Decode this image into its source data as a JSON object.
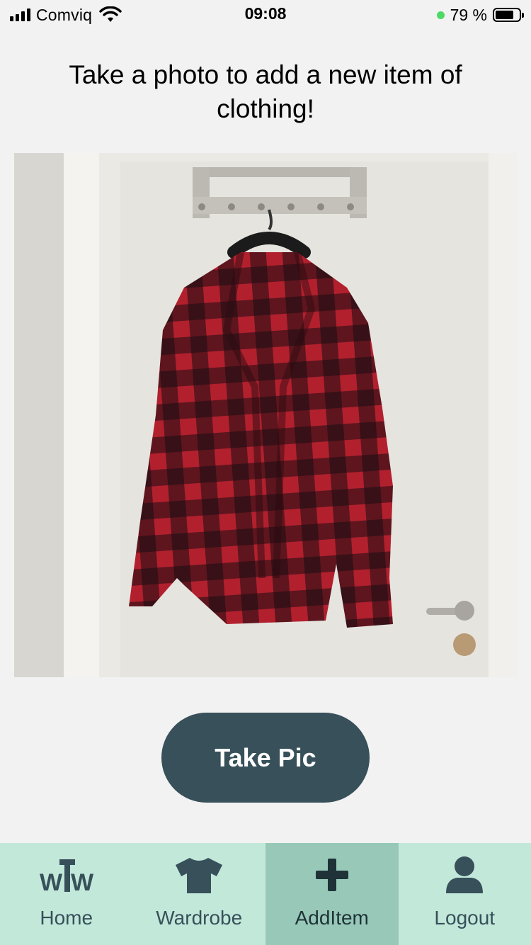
{
  "status_bar": {
    "carrier": "Comviq",
    "time": "09:08",
    "battery_text": "79 %",
    "battery_level": 0.79
  },
  "heading": "Take a photo to add a new item of clothing!",
  "photo": {
    "icon": "photo-plaid-shirt"
  },
  "take_pic_label": "Take Pic",
  "tabs": [
    {
      "label": "Home",
      "icon": "wtw-logo-icon",
      "active": false
    },
    {
      "label": "Wardrobe",
      "icon": "tshirt-icon",
      "active": false
    },
    {
      "label": "AddItem",
      "icon": "plus-icon",
      "active": true
    },
    {
      "label": "Logout",
      "icon": "user-icon",
      "active": false
    }
  ],
  "colors": {
    "primary": "#375059",
    "tab_bar_bg": "#c2e8da",
    "tab_active_bg": "#98c9b8",
    "page_bg": "#f2f2f2"
  }
}
